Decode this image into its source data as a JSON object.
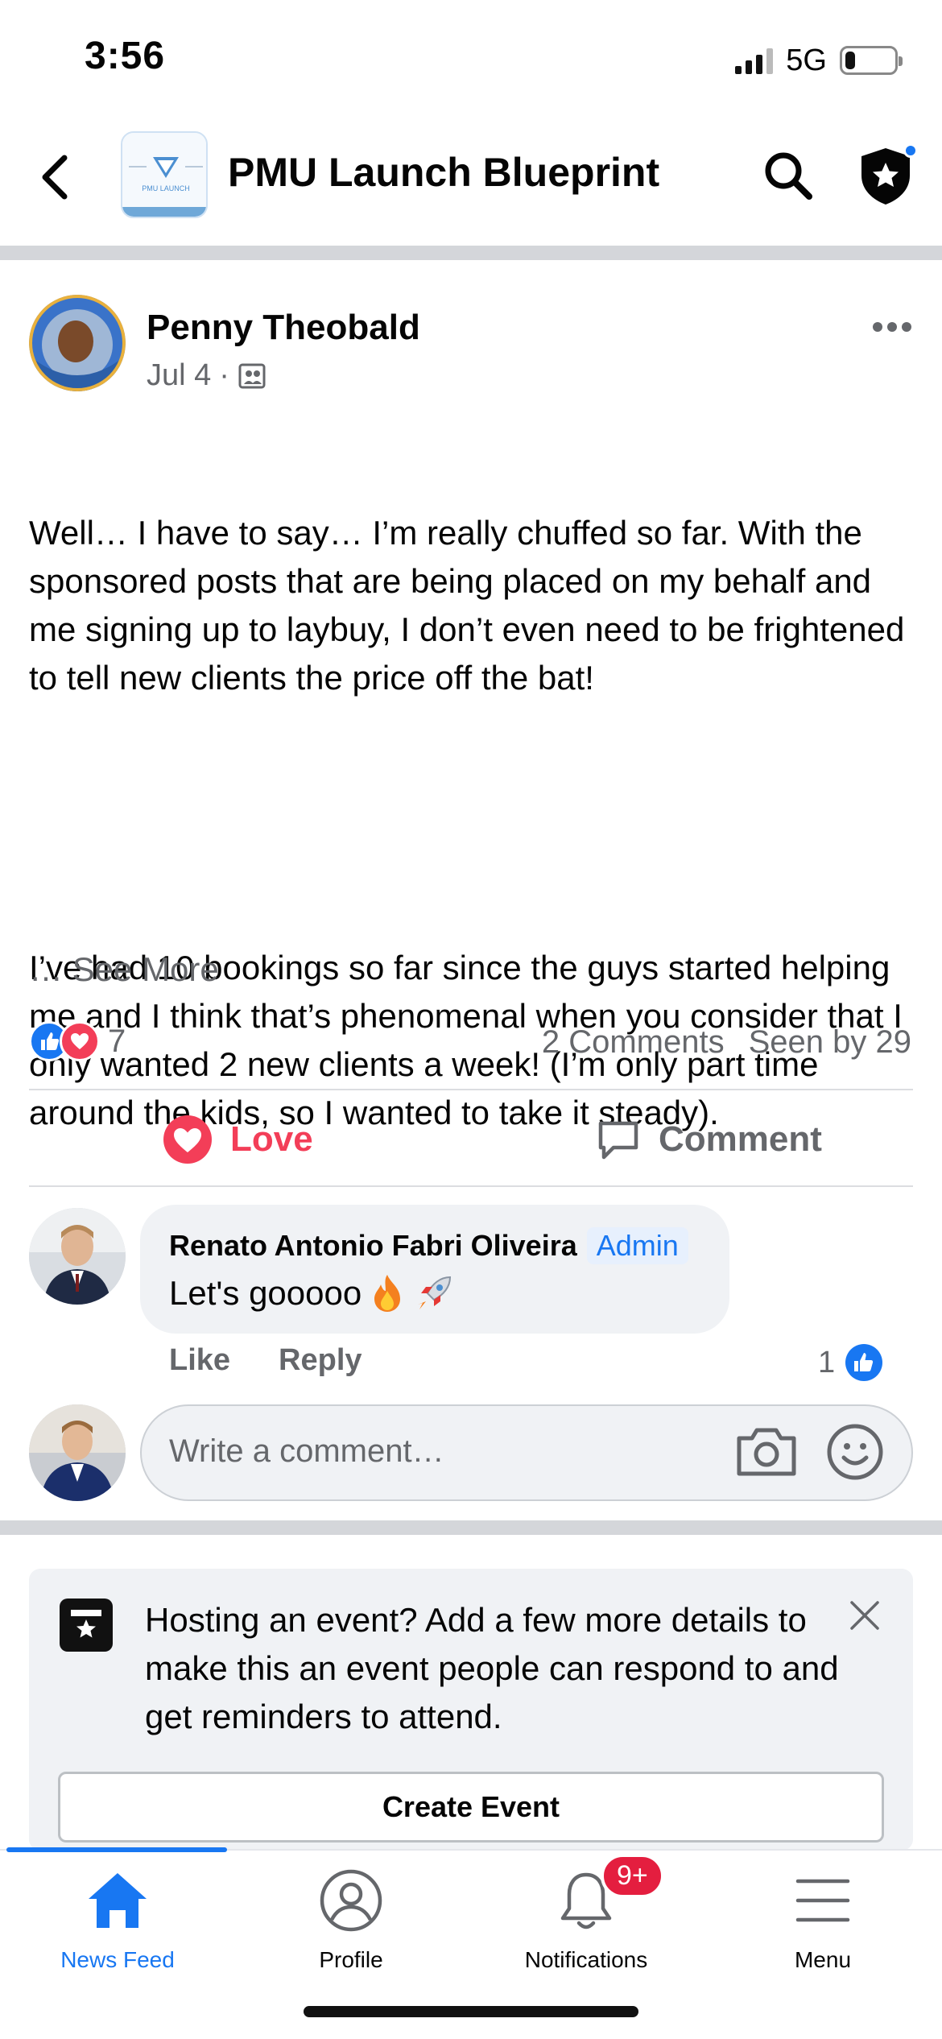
{
  "status_bar": {
    "time": "3:56",
    "network": "5G",
    "battery_level": 0.2
  },
  "header": {
    "title": "PMU Launch Blueprint",
    "group_logo_text": "PMU LAUNCH",
    "icons": [
      "back-icon",
      "search-icon",
      "admin-shield-icon"
    ]
  },
  "post": {
    "author": "Penny Theobald",
    "date": "Jul 4",
    "separator": "·",
    "paragraph1": "Well… I have to say… I’m really chuffed so far. With the sponsored posts that are being placed on my behalf and me signing up to laybuy, I don’t even need to be frightened to tell new clients the price off the bat!",
    "paragraph2": "I’ve had 10 bookings so far since the guys started helping me and I think that’s phenomenal when you consider that I only wanted 2 new clients a week! (I’m only part time around the kids, so I wanted to take it steady).",
    "ellipsis": "… ",
    "see_more": "See More",
    "reaction_count": "7",
    "comments_count": "2 Comments",
    "seen_by": "Seen by 29",
    "love_label": "Love",
    "comment_label": "Comment"
  },
  "comment": {
    "author": "Renato Antonio Fabri Oliveira",
    "role_badge": "Admin",
    "text": "Let's gooooo",
    "emojis": [
      "fire",
      "rocket"
    ],
    "like_label": "Like",
    "reply_label": "Reply",
    "like_count": "1"
  },
  "composer": {
    "placeholder": "Write a comment…"
  },
  "event_card": {
    "text": "Hosting an event? Add a few more details to make this an event people can respond to and get reminders to attend.",
    "button_label": "Create Event"
  },
  "tabbar": {
    "tabs": [
      {
        "label": "News Feed",
        "icon": "home-icon",
        "active": true
      },
      {
        "label": "Profile",
        "icon": "profile-icon",
        "active": false
      },
      {
        "label": "Notifications",
        "icon": "bell-icon",
        "active": false
      },
      {
        "label": "Menu",
        "icon": "menu-icon",
        "active": false
      }
    ],
    "notification_badge": "9+"
  },
  "colors": {
    "accent": "#1877f2",
    "love": "#f33e58",
    "badge": "#e41e3f",
    "secondary_text": "#65676b"
  }
}
